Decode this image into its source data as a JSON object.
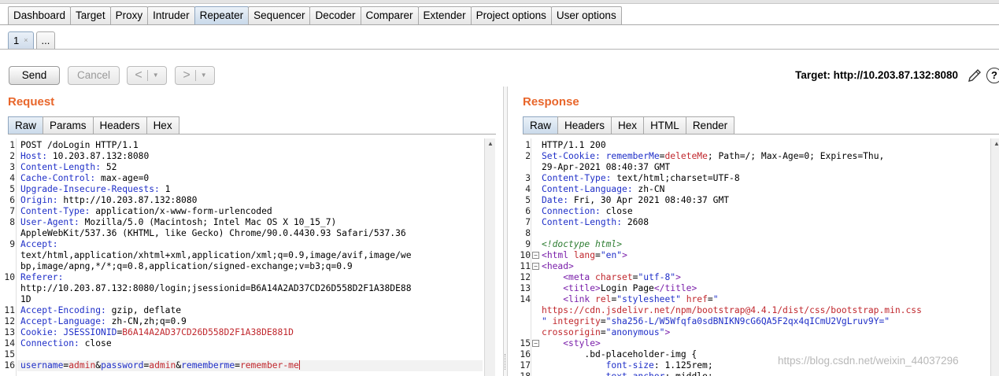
{
  "main_tabs": [
    {
      "label": "Dashboard",
      "active": false
    },
    {
      "label": "Target",
      "active": false
    },
    {
      "label": "Proxy",
      "active": false
    },
    {
      "label": "Intruder",
      "active": false
    },
    {
      "label": "Repeater",
      "active": true
    },
    {
      "label": "Sequencer",
      "active": false
    },
    {
      "label": "Decoder",
      "active": false
    },
    {
      "label": "Comparer",
      "active": false
    },
    {
      "label": "Extender",
      "active": false
    },
    {
      "label": "Project options",
      "active": false
    },
    {
      "label": "User options",
      "active": false
    }
  ],
  "repeater_tabs": {
    "current": "1",
    "close_glyph": "×",
    "more": "..."
  },
  "toolbar": {
    "send_label": "Send",
    "cancel_label": "Cancel",
    "back_glyph": "<",
    "forward_glyph": ">",
    "dropdown_glyph": "▼"
  },
  "target": {
    "text": "Target: http://10.203.87.132:8080",
    "help_glyph": "?"
  },
  "request": {
    "title": "Request",
    "tabs": [
      "Raw",
      "Params",
      "Headers",
      "Hex"
    ],
    "active_tab": "Raw",
    "lines": [
      {
        "n": "1",
        "rows": [
          [
            {
              "t": "POST /doLogin HTTP/1.1",
              "c": "v"
            }
          ]
        ]
      },
      {
        "n": "2",
        "rows": [
          [
            {
              "t": "Host:",
              "c": "k"
            },
            {
              "t": " 10.203.87.132:8080",
              "c": "v"
            }
          ]
        ]
      },
      {
        "n": "3",
        "rows": [
          [
            {
              "t": "Content-Length:",
              "c": "k"
            },
            {
              "t": " 52",
              "c": "v"
            }
          ]
        ]
      },
      {
        "n": "4",
        "rows": [
          [
            {
              "t": "Cache-Control:",
              "c": "k"
            },
            {
              "t": " max-age=0",
              "c": "v"
            }
          ]
        ]
      },
      {
        "n": "5",
        "rows": [
          [
            {
              "t": "Upgrade-Insecure-Requests:",
              "c": "k"
            },
            {
              "t": " 1",
              "c": "v"
            }
          ]
        ]
      },
      {
        "n": "6",
        "rows": [
          [
            {
              "t": "Origin:",
              "c": "k"
            },
            {
              "t": " http://10.203.87.132:8080",
              "c": "v"
            }
          ]
        ]
      },
      {
        "n": "7",
        "rows": [
          [
            {
              "t": "Content-Type:",
              "c": "k"
            },
            {
              "t": " application/x-www-form-urlencoded",
              "c": "v"
            }
          ]
        ]
      },
      {
        "n": "8",
        "rows": [
          [
            {
              "t": "User-Agent:",
              "c": "k"
            },
            {
              "t": " Mozilla/5.0 (Macintosh; Intel Mac OS X 10_15_7)",
              "c": "v"
            }
          ],
          [
            {
              "t": "AppleWebKit/537.36 (KHTML, like Gecko) Chrome/90.0.4430.93 Safari/537.36",
              "c": "v"
            }
          ]
        ]
      },
      {
        "n": "9",
        "rows": [
          [
            {
              "t": "Accept:",
              "c": "k"
            }
          ],
          [
            {
              "t": "text/html,application/xhtml+xml,application/xml;q=0.9,image/avif,image/we",
              "c": "v"
            }
          ],
          [
            {
              "t": "bp,image/apng,*/*;q=0.8,application/signed-exchange;v=b3;q=0.9",
              "c": "v"
            }
          ]
        ]
      },
      {
        "n": "10",
        "rows": [
          [
            {
              "t": "Referer:",
              "c": "k"
            }
          ],
          [
            {
              "t": "http://10.203.87.132:8080/login;jsessionid=B6A14A2AD37CD26D558D2F1A38DE88",
              "c": "v"
            }
          ],
          [
            {
              "t": "1D",
              "c": "v"
            }
          ]
        ]
      },
      {
        "n": "11",
        "rows": [
          [
            {
              "t": "Accept-Encoding:",
              "c": "k"
            },
            {
              "t": " gzip, deflate",
              "c": "v"
            }
          ]
        ]
      },
      {
        "n": "12",
        "rows": [
          [
            {
              "t": "Accept-Language:",
              "c": "k"
            },
            {
              "t": " zh-CN,zh;q=0.9",
              "c": "v"
            }
          ]
        ]
      },
      {
        "n": "13",
        "rows": [
          [
            {
              "t": "Cookie:",
              "c": "k"
            },
            {
              "t": " JSESSIONID",
              "c": "pn"
            },
            {
              "t": "=",
              "c": "v"
            },
            {
              "t": "B6A14A2AD37CD26D558D2F1A38DE881D",
              "c": "pv"
            }
          ]
        ]
      },
      {
        "n": "14",
        "rows": [
          [
            {
              "t": "Connection:",
              "c": "k"
            },
            {
              "t": " close",
              "c": "v"
            }
          ]
        ]
      },
      {
        "n": "15",
        "rows": [
          []
        ]
      },
      {
        "n": "16",
        "current": true,
        "rows": [
          [
            {
              "t": "username",
              "c": "pn"
            },
            {
              "t": "=",
              "c": "v"
            },
            {
              "t": "admin",
              "c": "pv"
            },
            {
              "t": "&",
              "c": "v"
            },
            {
              "t": "password",
              "c": "pn"
            },
            {
              "t": "=",
              "c": "v"
            },
            {
              "t": "admin",
              "c": "pv"
            },
            {
              "t": "&",
              "c": "v"
            },
            {
              "t": "rememberme",
              "c": "pn"
            },
            {
              "t": "=",
              "c": "v"
            },
            {
              "t": "remember-me",
              "c": "pv"
            }
          ]
        ]
      }
    ]
  },
  "response": {
    "title": "Response",
    "tabs": [
      "Raw",
      "Headers",
      "Hex",
      "HTML",
      "Render"
    ],
    "active_tab": "Raw",
    "fold_glyph": "−",
    "lines": [
      {
        "n": "1",
        "rows": [
          [
            {
              "t": "HTTP/1.1 200",
              "c": "v"
            }
          ]
        ]
      },
      {
        "n": "2",
        "rows": [
          [
            {
              "t": "Set-Cookie:",
              "c": "k"
            },
            {
              "t": " rememberMe",
              "c": "pn"
            },
            {
              "t": "=",
              "c": "v"
            },
            {
              "t": "deleteMe",
              "c": "pv"
            },
            {
              "t": "; Path=/; Max-Age=0; Expires=Thu,",
              "c": "v"
            }
          ],
          [
            {
              "t": "29-Apr-2021 08:40:37 GMT",
              "c": "v"
            }
          ]
        ]
      },
      {
        "n": "3",
        "rows": [
          [
            {
              "t": "Content-Type:",
              "c": "k"
            },
            {
              "t": " text/html;charset=UTF-8",
              "c": "v"
            }
          ]
        ]
      },
      {
        "n": "4",
        "rows": [
          [
            {
              "t": "Content-Language:",
              "c": "k"
            },
            {
              "t": " zh-CN",
              "c": "v"
            }
          ]
        ]
      },
      {
        "n": "5",
        "rows": [
          [
            {
              "t": "Date:",
              "c": "k"
            },
            {
              "t": " Fri, 30 Apr 2021 08:40:37 GMT",
              "c": "v"
            }
          ]
        ]
      },
      {
        "n": "6",
        "rows": [
          [
            {
              "t": "Connection:",
              "c": "k"
            },
            {
              "t": " close",
              "c": "v"
            }
          ]
        ]
      },
      {
        "n": "7",
        "rows": [
          [
            {
              "t": "Content-Length:",
              "c": "k"
            },
            {
              "t": " 2608",
              "c": "v"
            }
          ]
        ]
      },
      {
        "n": "8",
        "rows": [
          []
        ]
      },
      {
        "n": "9",
        "rows": [
          [
            {
              "t": "<!doctype html>",
              "c": "cmt"
            }
          ]
        ]
      },
      {
        "n": "10",
        "fold": true,
        "rows": [
          [
            {
              "t": "<",
              "c": "tag"
            },
            {
              "t": "html",
              "c": "tag"
            },
            {
              "t": " lang",
              "c": "attr"
            },
            {
              "t": "=",
              "c": "v"
            },
            {
              "t": "\"en\"",
              "c": "str"
            },
            {
              "t": ">",
              "c": "tag"
            }
          ]
        ]
      },
      {
        "n": "11",
        "fold": true,
        "rows": [
          [
            {
              "t": "<",
              "c": "tag"
            },
            {
              "t": "head",
              "c": "tag"
            },
            {
              "t": ">",
              "c": "tag"
            }
          ]
        ]
      },
      {
        "n": "12",
        "rows": [
          [
            {
              "t": "    <",
              "c": "tag"
            },
            {
              "t": "meta",
              "c": "tag"
            },
            {
              "t": " charset",
              "c": "attr"
            },
            {
              "t": "=",
              "c": "v"
            },
            {
              "t": "\"utf-8\"",
              "c": "str"
            },
            {
              "t": ">",
              "c": "tag"
            }
          ]
        ]
      },
      {
        "n": "13",
        "rows": [
          [
            {
              "t": "    <",
              "c": "tag"
            },
            {
              "t": "title",
              "c": "tag"
            },
            {
              "t": ">",
              "c": "tag"
            },
            {
              "t": "Login Page",
              "c": "v"
            },
            {
              "t": "</",
              "c": "tag"
            },
            {
              "t": "title",
              "c": "tag"
            },
            {
              "t": ">",
              "c": "tag"
            }
          ]
        ]
      },
      {
        "n": "14",
        "rows": [
          [
            {
              "t": "    <",
              "c": "tag"
            },
            {
              "t": "link",
              "c": "tag"
            },
            {
              "t": " rel",
              "c": "attr"
            },
            {
              "t": "=",
              "c": "v"
            },
            {
              "t": "\"stylesheet\"",
              "c": "str"
            },
            {
              "t": " href",
              "c": "attr"
            },
            {
              "t": "=",
              "c": "v"
            },
            {
              "t": "\"",
              "c": "str"
            }
          ],
          [
            {
              "t": "https://cdn.jsdelivr.net/npm/bootstrap@4.4.1/dist/css/bootstrap.min.css",
              "c": "attr"
            }
          ],
          [
            {
              "t": "\"",
              "c": "str"
            },
            {
              "t": " integrity",
              "c": "attr"
            },
            {
              "t": "=",
              "c": "v"
            },
            {
              "t": "\"sha256-L/W5Wfqfa0sdBNIKN9cG6QA5F2qx4qICmU2VgLruv9Y=\"",
              "c": "str"
            }
          ],
          [
            {
              "t": "crossorigin",
              "c": "attr"
            },
            {
              "t": "=",
              "c": "v"
            },
            {
              "t": "\"anonymous\"",
              "c": "str"
            },
            {
              "t": ">",
              "c": "tag"
            }
          ]
        ]
      },
      {
        "n": "15",
        "fold": true,
        "rows": [
          [
            {
              "t": "    <",
              "c": "tag"
            },
            {
              "t": "style",
              "c": "tag"
            },
            {
              "t": ">",
              "c": "tag"
            }
          ]
        ]
      },
      {
        "n": "16",
        "rows": [
          [
            {
              "t": "        .bd-placeholder-img {",
              "c": "v"
            }
          ]
        ]
      },
      {
        "n": "17",
        "rows": [
          [
            {
              "t": "            font-size",
              "c": "k"
            },
            {
              "t": ": ",
              "c": "v"
            },
            {
              "t": "1.125rem",
              "c": "v"
            },
            {
              "t": ";",
              "c": "v"
            }
          ]
        ]
      },
      {
        "n": "18",
        "rows": [
          [
            {
              "t": "            text-anchor",
              "c": "k"
            },
            {
              "t": ": middle;",
              "c": "v"
            }
          ]
        ]
      }
    ]
  },
  "watermark": "https://blog.csdn.net/weixin_44037296"
}
